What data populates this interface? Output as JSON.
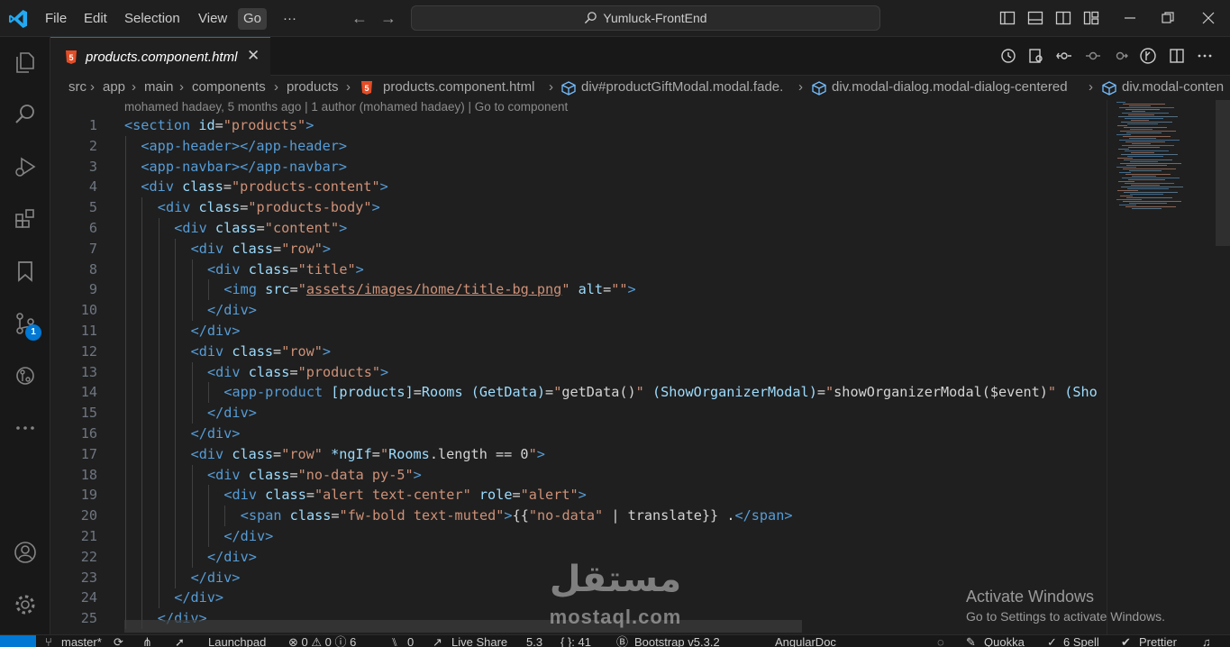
{
  "menu": [
    "File",
    "Edit",
    "Selection",
    "View",
    "Go"
  ],
  "menu_more": "···",
  "command_center": "Yumluck-FrontEnd",
  "tab": {
    "label": "products.component.html",
    "close": "✕"
  },
  "breadcrumb": {
    "items": [
      "src",
      "app",
      "main",
      "components",
      "products",
      "products.component.html",
      "div#productGiftModal.modal.fade.",
      "div.modal-dialog.modal-dialog-centered",
      "div.modal-conten"
    ],
    "sep": "›"
  },
  "blame": "mohamed hadaey, 5 months ago | 1 author (mohamed hadaey) | Go to component",
  "code_lines": [
    {
      "n": "1",
      "indent": 0,
      "tokens": [
        [
          "t",
          "<section"
        ],
        [
          "w",
          " "
        ],
        [
          "a",
          "id"
        ],
        [
          "w",
          "="
        ],
        [
          "s",
          "\"products\""
        ],
        [
          "t",
          ">"
        ]
      ]
    },
    {
      "n": "2",
      "indent": 1,
      "tokens": [
        [
          "t",
          "<app-header"
        ],
        [
          "t",
          "></app-header>"
        ]
      ]
    },
    {
      "n": "3",
      "indent": 1,
      "tokens": [
        [
          "t",
          "<app-navbar"
        ],
        [
          "t",
          "></app-navbar>"
        ]
      ]
    },
    {
      "n": "4",
      "indent": 1,
      "tokens": [
        [
          "t",
          "<div"
        ],
        [
          "w",
          " "
        ],
        [
          "a",
          "class"
        ],
        [
          "w",
          "="
        ],
        [
          "s",
          "\"products-content\""
        ],
        [
          "t",
          ">"
        ]
      ]
    },
    {
      "n": "5",
      "indent": 2,
      "tokens": [
        [
          "t",
          "<div"
        ],
        [
          "w",
          " "
        ],
        [
          "a",
          "class"
        ],
        [
          "w",
          "="
        ],
        [
          "s",
          "\"products-body\""
        ],
        [
          "t",
          ">"
        ]
      ]
    },
    {
      "n": "6",
      "indent": 3,
      "tokens": [
        [
          "t",
          "<div"
        ],
        [
          "w",
          " "
        ],
        [
          "a",
          "class"
        ],
        [
          "w",
          "="
        ],
        [
          "s",
          "\"content\""
        ],
        [
          "t",
          ">"
        ]
      ]
    },
    {
      "n": "7",
      "indent": 4,
      "tokens": [
        [
          "t",
          "<div"
        ],
        [
          "w",
          " "
        ],
        [
          "a",
          "class"
        ],
        [
          "w",
          "="
        ],
        [
          "s",
          "\"row\""
        ],
        [
          "t",
          ">"
        ]
      ]
    },
    {
      "n": "8",
      "indent": 5,
      "tokens": [
        [
          "t",
          "<div"
        ],
        [
          "w",
          " "
        ],
        [
          "a",
          "class"
        ],
        [
          "w",
          "="
        ],
        [
          "s",
          "\"title\""
        ],
        [
          "t",
          ">"
        ]
      ]
    },
    {
      "n": "9",
      "indent": 6,
      "tokens": [
        [
          "t",
          "<img"
        ],
        [
          "w",
          " "
        ],
        [
          "a",
          "src"
        ],
        [
          "w",
          "="
        ],
        [
          "s",
          "\""
        ],
        [
          "su",
          "assets/images/home/title-bg.png"
        ],
        [
          "s",
          "\""
        ],
        [
          "w",
          " "
        ],
        [
          "a",
          "alt"
        ],
        [
          "w",
          "="
        ],
        [
          "s",
          "\"\""
        ],
        [
          "t",
          ">"
        ]
      ]
    },
    {
      "n": "10",
      "indent": 5,
      "tokens": [
        [
          "t",
          "</div>"
        ]
      ]
    },
    {
      "n": "11",
      "indent": 4,
      "tokens": [
        [
          "t",
          "</div>"
        ]
      ]
    },
    {
      "n": "12",
      "indent": 4,
      "tokens": [
        [
          "t",
          "<div"
        ],
        [
          "w",
          " "
        ],
        [
          "a",
          "class"
        ],
        [
          "w",
          "="
        ],
        [
          "s",
          "\"row\""
        ],
        [
          "t",
          ">"
        ]
      ]
    },
    {
      "n": "13",
      "indent": 5,
      "tokens": [
        [
          "t",
          "<div"
        ],
        [
          "w",
          " "
        ],
        [
          "a",
          "class"
        ],
        [
          "w",
          "="
        ],
        [
          "s",
          "\"products\""
        ],
        [
          "t",
          ">"
        ]
      ]
    },
    {
      "n": "14",
      "indent": 6,
      "tokens": [
        [
          "t",
          "<app-product"
        ],
        [
          "w",
          " "
        ],
        [
          "a",
          "[products]"
        ],
        [
          "w",
          "="
        ],
        [
          "a",
          "Rooms"
        ],
        [
          "w",
          " "
        ],
        [
          "a",
          "(GetData)"
        ],
        [
          "w",
          "="
        ],
        [
          "s",
          "\""
        ],
        [
          "w",
          "getData()"
        ],
        [
          "s",
          "\""
        ],
        [
          "w",
          " "
        ],
        [
          "a",
          "(ShowOrganizerModal)"
        ],
        [
          "w",
          "="
        ],
        [
          "s",
          "\""
        ],
        [
          "w",
          "showOrganizerModal($event)"
        ],
        [
          "s",
          "\""
        ],
        [
          "w",
          " "
        ],
        [
          "a",
          "(Sho"
        ]
      ]
    },
    {
      "n": "15",
      "indent": 5,
      "tokens": [
        [
          "t",
          "</div>"
        ]
      ]
    },
    {
      "n": "16",
      "indent": 4,
      "tokens": [
        [
          "t",
          "</div>"
        ]
      ]
    },
    {
      "n": "17",
      "indent": 4,
      "tokens": [
        [
          "t",
          "<div"
        ],
        [
          "w",
          " "
        ],
        [
          "a",
          "class"
        ],
        [
          "w",
          "="
        ],
        [
          "s",
          "\"row\""
        ],
        [
          "w",
          " "
        ],
        [
          "a",
          "*ngIf"
        ],
        [
          "w",
          "="
        ],
        [
          "s",
          "\""
        ],
        [
          "a",
          "Rooms"
        ],
        [
          "w",
          ".length == 0"
        ],
        [
          "s",
          "\""
        ],
        [
          "t",
          ">"
        ]
      ]
    },
    {
      "n": "18",
      "indent": 5,
      "tokens": [
        [
          "t",
          "<div"
        ],
        [
          "w",
          " "
        ],
        [
          "a",
          "class"
        ],
        [
          "w",
          "="
        ],
        [
          "s",
          "\"no-data py-5\""
        ],
        [
          "t",
          ">"
        ]
      ]
    },
    {
      "n": "19",
      "indent": 6,
      "tokens": [
        [
          "t",
          "<div"
        ],
        [
          "w",
          " "
        ],
        [
          "a",
          "class"
        ],
        [
          "w",
          "="
        ],
        [
          "s",
          "\"alert text-center\""
        ],
        [
          "w",
          " "
        ],
        [
          "a",
          "role"
        ],
        [
          "w",
          "="
        ],
        [
          "s",
          "\"alert\""
        ],
        [
          "t",
          ">"
        ]
      ]
    },
    {
      "n": "20",
      "indent": 7,
      "tokens": [
        [
          "t",
          "<span"
        ],
        [
          "w",
          " "
        ],
        [
          "a",
          "class"
        ],
        [
          "w",
          "="
        ],
        [
          "s",
          "\"fw-bold text-muted\""
        ],
        [
          "t",
          ">"
        ],
        [
          "w",
          "{{"
        ],
        [
          "s",
          "\"no-data\""
        ],
        [
          "w",
          " | translate}} ."
        ],
        [
          "t",
          "</span>"
        ]
      ]
    },
    {
      "n": "21",
      "indent": 6,
      "tokens": [
        [
          "t",
          "</div>"
        ]
      ]
    },
    {
      "n": "22",
      "indent": 5,
      "tokens": [
        [
          "t",
          "</div>"
        ]
      ]
    },
    {
      "n": "23",
      "indent": 4,
      "tokens": [
        [
          "t",
          "</div>"
        ]
      ]
    },
    {
      "n": "24",
      "indent": 3,
      "tokens": [
        [
          "t",
          "</div>"
        ]
      ]
    },
    {
      "n": "25",
      "indent": 2,
      "tokens": [
        [
          "t",
          "</div>"
        ]
      ]
    }
  ],
  "watermark": {
    "title": "Activate Windows",
    "subtitle": "Go to Settings to activate Windows."
  },
  "logo_watermark": {
    "arabic": "مستقل",
    "latin": "mostaql.com"
  },
  "scm_badge": "1",
  "statusbar": {
    "branch": "master*",
    "launchpad": "Launchpad",
    "problems": "⊗ 0  ⚠ 0  ⓘ 6",
    "ports": "0",
    "live_share": "Live Share",
    "version": "5.3",
    "braces": "{ }: 41",
    "bootstrap": "Bootstrap v5.3.2",
    "angular": "AngularDoc",
    "quokka": "Quokka",
    "spell": "6 Spell",
    "prettier": "Prettier"
  },
  "colors": {
    "accent": "#0078d4",
    "tag": "#569cd6",
    "attribute": "#9cdcfe",
    "string": "#ce9178",
    "plain": "#d4d4d4",
    "html_icon": "#e44d26"
  }
}
